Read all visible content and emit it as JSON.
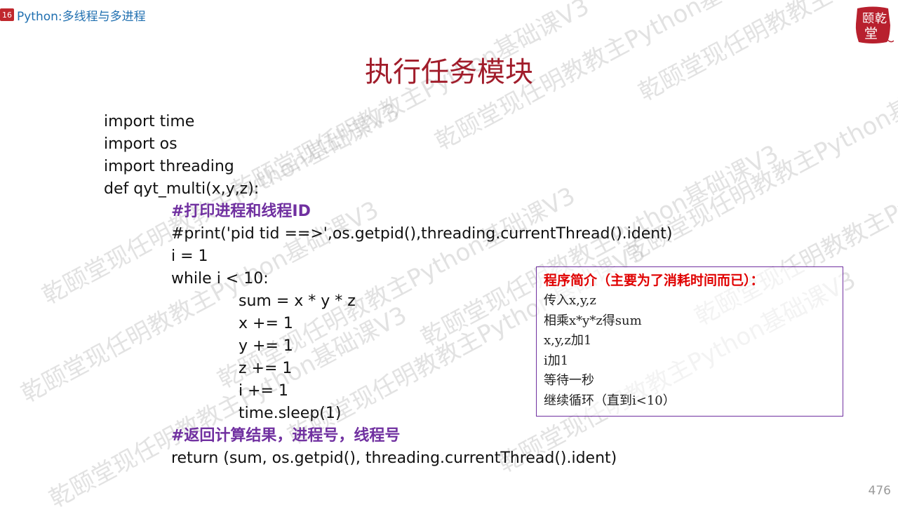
{
  "header": {
    "badge": "16",
    "title": "Python:多线程与多进程"
  },
  "title": "执行任务模块",
  "code_lines": [
    {
      "text": "import time",
      "indent": 0,
      "comment": false
    },
    {
      "text": "import os",
      "indent": 0,
      "comment": false
    },
    {
      "text": "import threading",
      "indent": 0,
      "comment": false
    },
    {
      "text": "def qyt_multi(x,y,z):",
      "indent": 0,
      "comment": false
    },
    {
      "text": "#打印进程和线程ID",
      "indent": 1,
      "comment": true
    },
    {
      "text": "#print('pid tid ==>',os.getpid(),threading.currentThread().ident)",
      "indent": 1,
      "comment": false
    },
    {
      "text": "i = 1",
      "indent": 1,
      "comment": false
    },
    {
      "text": "while i < 10:",
      "indent": 1,
      "comment": false
    },
    {
      "text": "sum = x * y * z",
      "indent": 2,
      "comment": false
    },
    {
      "text": "x += 1",
      "indent": 2,
      "comment": false
    },
    {
      "text": "y += 1",
      "indent": 2,
      "comment": false
    },
    {
      "text": "z += 1",
      "indent": 2,
      "comment": false
    },
    {
      "text": "i += 1",
      "indent": 2,
      "comment": false
    },
    {
      "text": "time.sleep(1)",
      "indent": 2,
      "comment": false
    },
    {
      "text": "#返回计算结果，进程号，线程号",
      "indent": 1,
      "comment": true
    },
    {
      "text": "return (sum, os.getpid(), threading.currentThread().ident)",
      "indent": 1,
      "comment": false
    }
  ],
  "info_box": {
    "title": "程序简介（主要为了消耗时间而已）：",
    "items": [
      "传入x,y,z",
      "相乘x*y*z得sum",
      "x,y,z加1",
      "i加1",
      "等待一秒",
      "继续循环（直到i<10）"
    ]
  },
  "watermark": "乾颐堂现任明教教主Python基础课V3",
  "logo": {
    "text": "颐乾堂",
    "color": "#b8202e"
  },
  "page_number": "476"
}
